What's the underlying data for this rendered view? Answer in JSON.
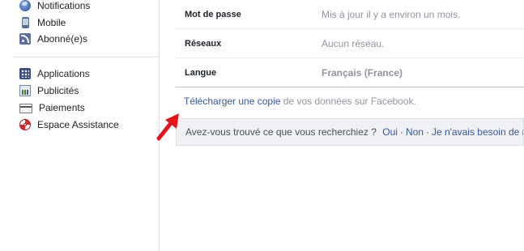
{
  "sidebar": {
    "top_items": [
      {
        "label": "Notifications",
        "icon": "globe-icon"
      },
      {
        "label": "Mobile",
        "icon": "mobile-icon"
      },
      {
        "label": "Abonné(e)s",
        "icon": "rss-icon"
      }
    ],
    "bottom_items": [
      {
        "label": "Applications",
        "icon": "apps-icon"
      },
      {
        "label": "Publicités",
        "icon": "ads-icon"
      },
      {
        "label": "Paiements",
        "icon": "card-icon"
      },
      {
        "label": "Espace Assistance",
        "icon": "lifebuoy-icon"
      }
    ]
  },
  "settings": {
    "rows": [
      {
        "label": "Mot de passe",
        "value": "Mis à jour il y a environ un mois."
      },
      {
        "label": "Réseaux",
        "value": "Aucun réseau."
      },
      {
        "label": "Langue",
        "value": "Français (France)"
      }
    ]
  },
  "download": {
    "link_text": "Télécharger une copie",
    "suffix_text": " de vos données sur Facebook."
  },
  "feedback": {
    "question": "Avez-vous trouvé ce que vous recherchiez ?",
    "yes": "Oui",
    "no": "Non",
    "other": "Je n'avais besoin de rien"
  },
  "colors": {
    "link": "#365899",
    "arrow": "#e3141c"
  }
}
